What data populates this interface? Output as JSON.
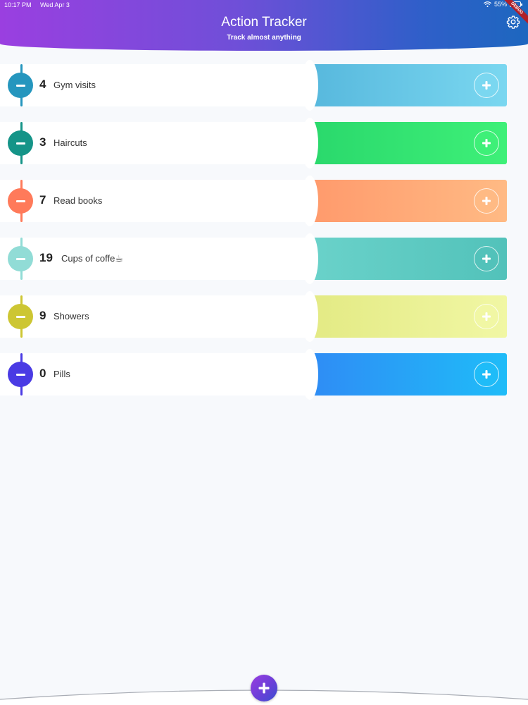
{
  "status_bar": {
    "time": "10:17 PM",
    "date": "Wed Apr 3",
    "battery": "55%"
  },
  "header": {
    "title": "Action Tracker",
    "subtitle": "Track almost anything",
    "settings_icon": "gear-icon",
    "debug_banner": "DEBUG"
  },
  "trackers": [
    {
      "count": "4",
      "name": "Gym visits",
      "color": "#2596be",
      "bar_from": "#57b8dd",
      "bar_to": "#7ad7f0"
    },
    {
      "count": "3",
      "name": "Haircuts",
      "color": "#159488",
      "bar_from": "#2ad86c",
      "bar_to": "#3ef078"
    },
    {
      "count": "7",
      "name": "Read books",
      "color": "#ff7a5a",
      "bar_from": "#ff9a6c",
      "bar_to": "#ffba84"
    },
    {
      "count": "19",
      "name": "Cups of coffe☕",
      "color": "#91dcd6",
      "bar_from": "#6ad2ca",
      "bar_to": "#52c2ba"
    },
    {
      "count": "9",
      "name": "Showers",
      "color": "#cdc633",
      "bar_from": "#e3ea84",
      "bar_to": "#f1f7a4"
    },
    {
      "count": "0",
      "name": "Pills",
      "color": "#4a3be4",
      "bar_from": "#2f8cf5",
      "bar_to": "#1fbcf8"
    }
  ],
  "fab": {
    "icon": "plus-icon",
    "color_from": "#9a3fe0",
    "color_to": "#3a4fd0"
  }
}
